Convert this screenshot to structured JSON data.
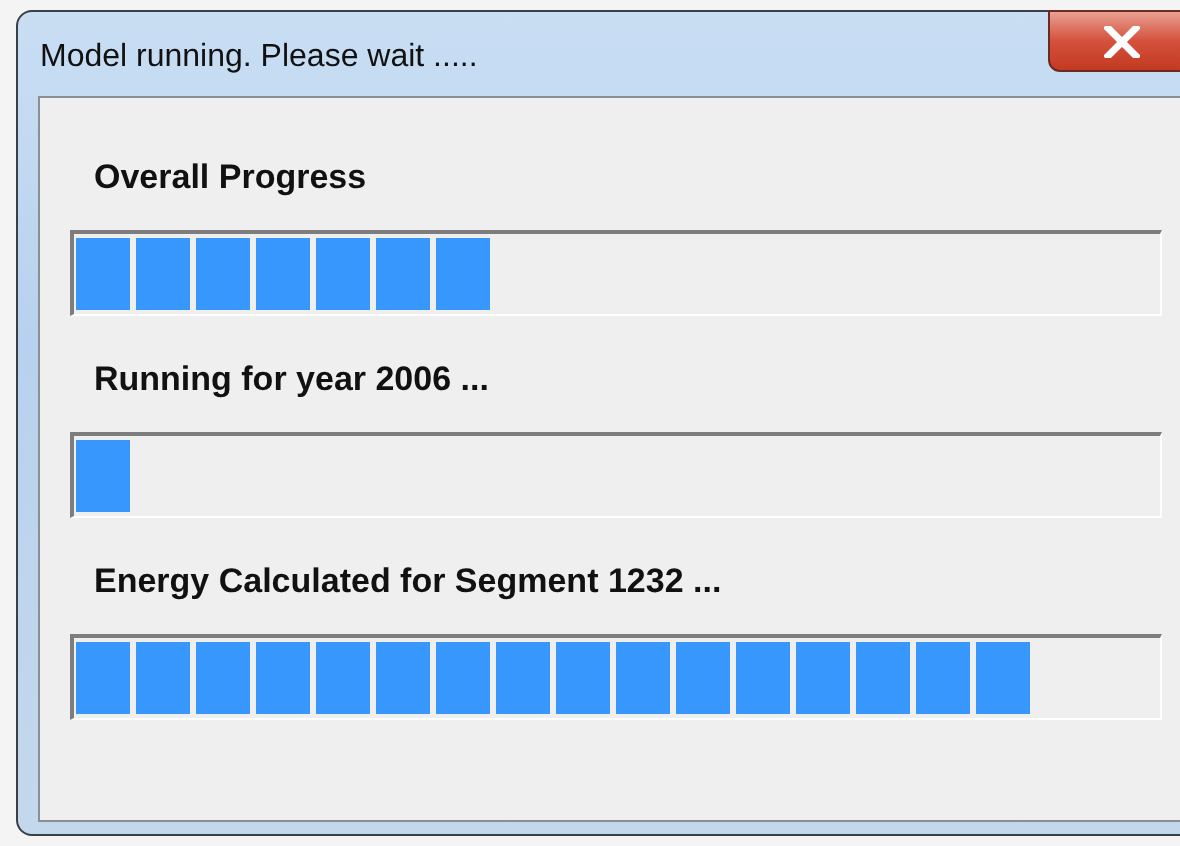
{
  "window": {
    "title": "Model running. Please wait ....."
  },
  "progress": [
    {
      "label": "Overall Progress",
      "level": 0.38
    },
    {
      "label": "Running for year 2006 ...",
      "level": 0.055
    },
    {
      "label": "Energy Calculated for Segment 1232 ...",
      "level": 0.86
    }
  ]
}
